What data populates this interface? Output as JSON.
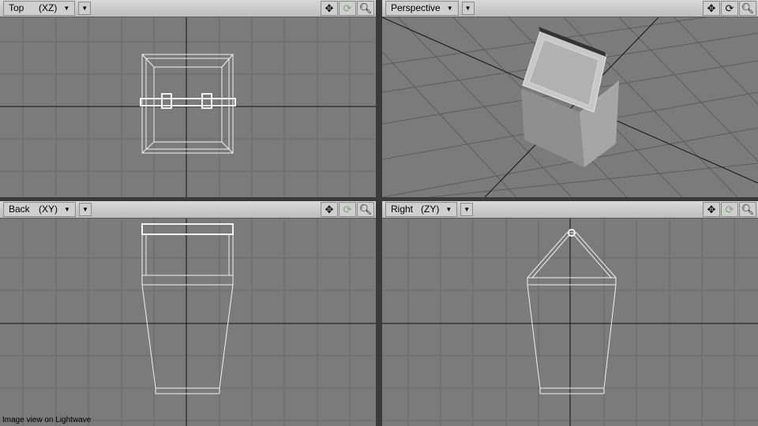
{
  "viewports": {
    "top": {
      "label": "Top",
      "axes": "(XZ)"
    },
    "persp": {
      "label": "Perspective"
    },
    "back": {
      "label": "Back",
      "axes": "(XY)"
    },
    "right": {
      "label": "Right",
      "axes": "(ZY)"
    }
  },
  "icons": {
    "move": "move-view-icon",
    "rotate": "rotate-view-icon",
    "zoom": "zoom-view-icon",
    "dropdown": "chevron-down-icon"
  },
  "caption": "Image view on Lightwave"
}
